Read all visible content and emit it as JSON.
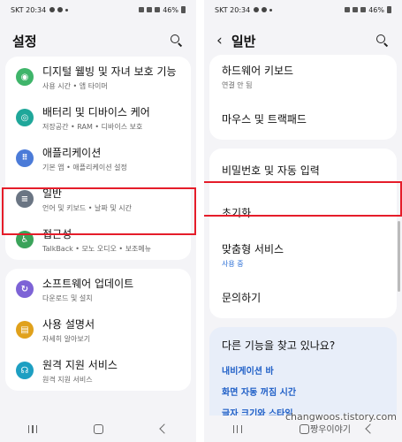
{
  "left": {
    "status": {
      "carrier_time": "SKT 20:34",
      "battery": "46%"
    },
    "header": {
      "title": "설정"
    },
    "items": [
      {
        "title": "디지털 웰빙 및 자녀 보호 기능",
        "subtitle": "사용 시간 • 앱 타이머",
        "icon": "digital-wellbeing-icon",
        "color": "#3fb56a"
      },
      {
        "title": "배터리 및 디바이스 케어",
        "subtitle": "저장공간 • RAM • 디바이스 보호",
        "icon": "device-care-icon",
        "color": "#1fa79a"
      },
      {
        "title": "애플리케이션",
        "subtitle": "기본 앱 • 애플리케이션 설정",
        "icon": "apps-icon",
        "color": "#4b7bd8"
      },
      {
        "title": "일반",
        "subtitle": "언어 및 키보드 • 날짜 및 시간",
        "icon": "general-sliders-icon",
        "color": "#6a7583"
      },
      {
        "title": "접근성",
        "subtitle": "TalkBack • 모노 오디오 • 보조메뉴",
        "icon": "accessibility-icon",
        "color": "#3aa35a"
      },
      {
        "title": "소프트웨어 업데이트",
        "subtitle": "다운로드 및 설치",
        "icon": "software-update-icon",
        "color": "#7d63d6"
      },
      {
        "title": "사용 설명서",
        "subtitle": "자세히 알아보기",
        "icon": "user-manual-icon",
        "color": "#e0a11b"
      },
      {
        "title": "원격 지원 서비스",
        "subtitle": "원격 지원 서비스",
        "icon": "remote-support-icon",
        "color": "#1d9fc2"
      }
    ]
  },
  "right": {
    "status": {
      "carrier_time": "SKT 20:34",
      "battery": "46%"
    },
    "header": {
      "title": "일반"
    },
    "items": [
      {
        "title": "하드웨어 키보드",
        "subtitle": "연결 안 됨"
      },
      {
        "title": "마우스 및 트랙패드",
        "subtitle": ""
      },
      {
        "title": "비밀번호 및 자동 입력",
        "subtitle": ""
      },
      {
        "title": "초기화",
        "subtitle": ""
      },
      {
        "title": "맞춤형 서비스",
        "subtitle": "사용 중"
      },
      {
        "title": "문의하기",
        "subtitle": ""
      }
    ],
    "suggest": {
      "question": "다른 기능을 찾고 있나요?",
      "links": [
        "내비게이션 바",
        "화면 자동 꺼짐 시간",
        "글자 크기와 스타일"
      ]
    }
  },
  "watermark": {
    "site": "changwoos.tistory.com",
    "name": "짱우이야기"
  },
  "colors": {
    "highlight": "#e51d2a",
    "accent": "#2b6fd6",
    "background": "#f4f4f7"
  }
}
